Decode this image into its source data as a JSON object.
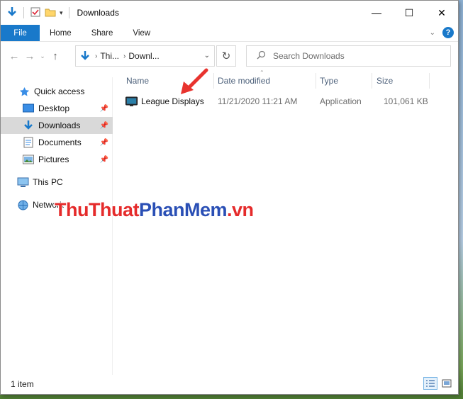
{
  "window": {
    "title": "Downloads",
    "controls": {
      "minimize": "—",
      "maximize": "☐",
      "close": "✕"
    }
  },
  "ribbon": {
    "tabs": [
      "File",
      "Home",
      "Share",
      "View"
    ],
    "help": "?"
  },
  "address": {
    "crumbs": [
      "Thi...",
      "Downl..."
    ],
    "search_placeholder": "Search Downloads"
  },
  "nav": {
    "quick_access": "Quick access",
    "items": [
      {
        "label": "Desktop",
        "pinned": true
      },
      {
        "label": "Downloads",
        "pinned": true,
        "selected": true
      },
      {
        "label": "Documents",
        "pinned": true
      },
      {
        "label": "Pictures",
        "pinned": true
      }
    ],
    "this_pc": "This PC",
    "network": "Network"
  },
  "columns": {
    "name": "Name",
    "date_modified": "Date modified",
    "type": "Type",
    "size": "Size"
  },
  "files": [
    {
      "name": "League Displays",
      "date_modified": "11/21/2020 11:21 AM",
      "type": "Application",
      "size": "101,061 KB"
    }
  ],
  "status": {
    "item_count": "1 item"
  },
  "watermark": {
    "part1": "ThuThuat",
    "part2": "PhanMem",
    "part3": ".vn"
  },
  "colors": {
    "accent": "#1979ca",
    "selected_bg": "#d9d9d9",
    "header_text": "#4c607a",
    "watermark_red": "#e52b2b",
    "watermark_blue": "#2a4fb5"
  }
}
